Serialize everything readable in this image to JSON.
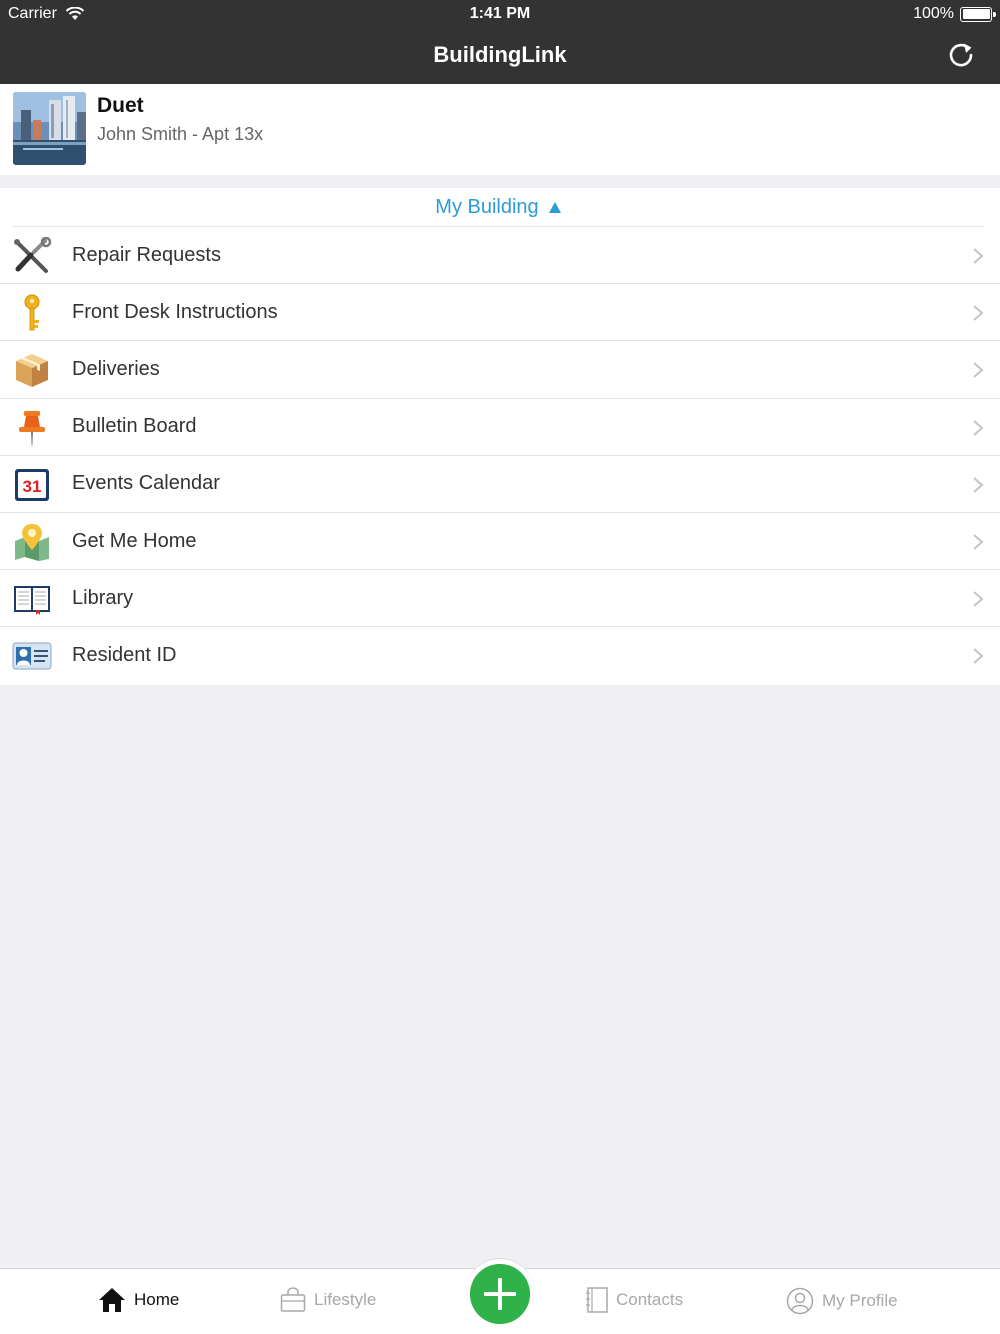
{
  "status": {
    "carrier": "Carrier",
    "time": "1:41 PM",
    "battery_text": "100%",
    "battery_level": 1.0
  },
  "nav": {
    "title": "BuildingLink",
    "refresh_icon": "refresh-icon"
  },
  "building": {
    "name": "Duet",
    "resident": "John Smith - Apt 13x"
  },
  "section": {
    "title": "My Building",
    "accent": "#2e9bd6"
  },
  "menu": [
    {
      "label": "Repair Requests",
      "icon": "tools-icon"
    },
    {
      "label": "Front Desk Instructions",
      "icon": "key-icon"
    },
    {
      "label": "Deliveries",
      "icon": "package-icon"
    },
    {
      "label": "Bulletin Board",
      "icon": "pushpin-icon"
    },
    {
      "label": "Events Calendar",
      "icon": "calendar-icon",
      "calendar_day": "31"
    },
    {
      "label": "Get Me Home",
      "icon": "map-pin-icon"
    },
    {
      "label": "Library",
      "icon": "book-icon"
    },
    {
      "label": "Resident ID",
      "icon": "id-card-icon"
    }
  ],
  "tabbar": {
    "home": "Home",
    "lifestyle": "Lifestyle",
    "contacts": "Contacts",
    "profile": "My Profile",
    "add_color": "#2fb24a"
  }
}
